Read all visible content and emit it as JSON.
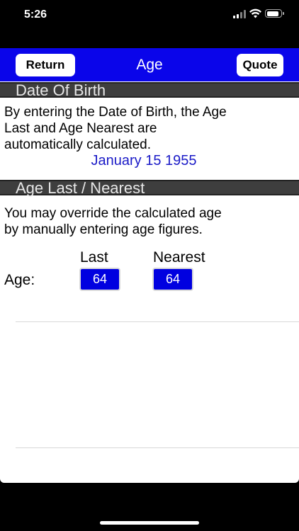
{
  "status_bar": {
    "time": "5:26"
  },
  "nav": {
    "return_label": "Return",
    "title": "Age",
    "quote_label": "Quote",
    "bar_color": "#0a05ea"
  },
  "dob_section": {
    "header": "Date Of Birth",
    "description_lines": [
      "By entering the Date of Birth, the Age",
      "Last and Age Nearest are",
      "automatically calculated."
    ],
    "date_value": "January 15 1955"
  },
  "age_section": {
    "header": "Age Last / Nearest",
    "description_lines": [
      "You may override the calculated age",
      "by manually entering age figures."
    ],
    "last_label": "Last",
    "nearest_label": "Nearest",
    "age_label": "Age:",
    "last_value": "64",
    "nearest_value": "64"
  }
}
